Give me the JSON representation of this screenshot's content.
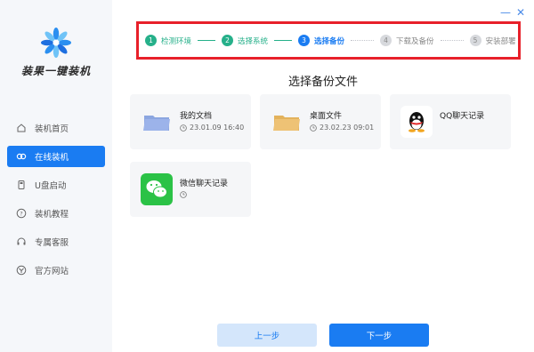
{
  "app": {
    "brand": "装果一键装机"
  },
  "sidebar": {
    "items": [
      {
        "label": "装机首页",
        "icon": "home-icon"
      },
      {
        "label": "在线装机",
        "icon": "online-install-icon"
      },
      {
        "label": "U盘启动",
        "icon": "usb-icon"
      },
      {
        "label": "装机教程",
        "icon": "help-icon"
      },
      {
        "label": "专属客服",
        "icon": "headset-icon"
      },
      {
        "label": "官方网站",
        "icon": "website-icon"
      }
    ],
    "active_index": 1
  },
  "window": {
    "minimize": "—",
    "close": "✕"
  },
  "steps": [
    {
      "num": "1",
      "label": "检测环境",
      "state": "done"
    },
    {
      "num": "2",
      "label": "选择系统",
      "state": "done"
    },
    {
      "num": "3",
      "label": "选择备份",
      "state": "current"
    },
    {
      "num": "4",
      "label": "下载及备份",
      "state": "todo"
    },
    {
      "num": "5",
      "label": "安装部署",
      "state": "todo"
    }
  ],
  "main": {
    "title": "选择备份文件",
    "cards": [
      {
        "name": "我的文档",
        "time": "23.01.09 16:40",
        "icon": "blue-folder-icon"
      },
      {
        "name": "桌面文件",
        "time": "23.02.23 09:01",
        "icon": "yellow-folder-icon"
      },
      {
        "name": "QQ聊天记录",
        "time": "",
        "icon": "qq-icon"
      },
      {
        "name": "微信聊天记录",
        "time": "",
        "icon": "wechat-icon"
      }
    ]
  },
  "buttons": {
    "prev": "上一步",
    "next": "下一步"
  },
  "colors": {
    "accent": "#1a7cf2",
    "done": "#26b08a",
    "highlight_border": "#e8202a"
  }
}
